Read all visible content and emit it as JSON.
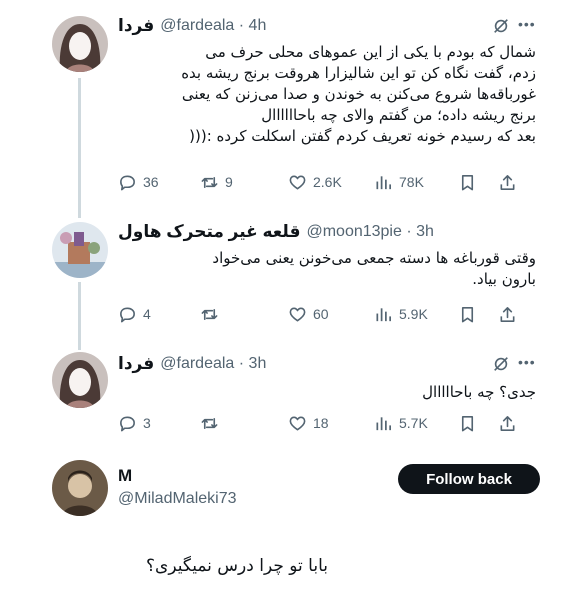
{
  "tweets": [
    {
      "name": "فردا",
      "handle": "@fardeala · 4h",
      "text_lines": [
        "شمال که بودم با یکی از این عموهای محلی حرف می",
        "زدم، گفت نگاه کن تو این شالیزارا هروقت برنج ریشه بده",
        "غورباقه‌ها شروع می‌کنن به خوندن و صدا می‌زنن که یعنی",
        "برنج ریشه داده؛ من گفتم والای چه باحاااااال",
        "بعد که رسیدم خونه تعریف کردم گفتن اسکلت کرده :((("
      ],
      "replies": "36",
      "reposts": "9",
      "likes": "2.6K",
      "views": "78K"
    },
    {
      "name": "قلعه غیر متحرک هاول",
      "handle": "@moon13pie · 3h",
      "text_lines": [
        "وقتی قورباغه ها دسته جمعی می‌خونن یعنی می‌خواد",
        "بارون بیاد."
      ],
      "replies": "4",
      "reposts": "",
      "likes": "60",
      "views": "5.9K"
    },
    {
      "name": "فردا",
      "handle": "@fardeala · 3h",
      "text_lines": [
        "جدی؟ چه باحااااال"
      ],
      "replies": "3",
      "reposts": "",
      "likes": "18",
      "views": "5.7K"
    }
  ],
  "profile": {
    "name": "M",
    "handle": "@MiladMaleki73",
    "follow_label": "Follow back"
  },
  "reply_text": "بابا تو چرا درس نمیگیری؟",
  "icons": [
    "grok-icon",
    "more-icon",
    "reply-icon",
    "repost-icon",
    "like-icon",
    "views-icon",
    "bookmark-icon",
    "share-icon"
  ],
  "colors": {
    "text": "#0f1419",
    "secondary": "#536471",
    "thread_line": "#cfd9de",
    "button": "#0f1419"
  }
}
